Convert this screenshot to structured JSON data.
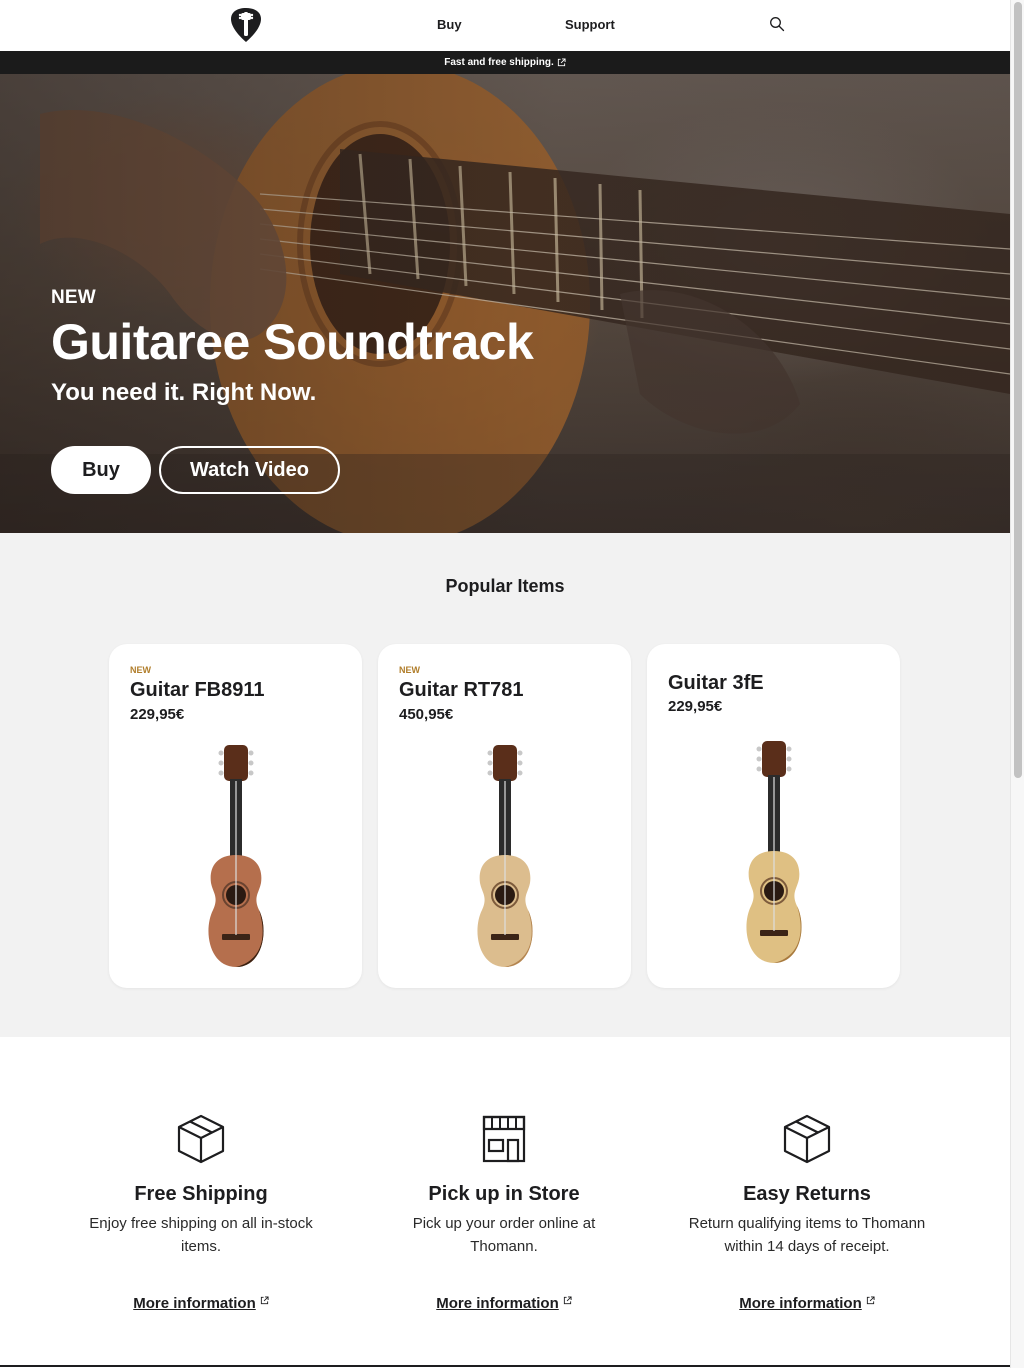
{
  "header": {
    "logo_icon": "guitar-pick-logo-icon",
    "nav": [
      {
        "label": "Buy"
      },
      {
        "label": "Support"
      }
    ],
    "search_icon": "search-icon"
  },
  "promo": {
    "text": "Fast and free shipping.",
    "icon": "external-link-icon"
  },
  "hero": {
    "eyebrow": "NEW",
    "title": "Guitaree Soundtrack",
    "subtitle": "You need it. Right Now.",
    "buy_label": "Buy",
    "video_label": "Watch Video"
  },
  "popular": {
    "title": "Popular Items",
    "items": [
      {
        "badge": "NEW",
        "name": "Guitar FB8911",
        "price": "229,95€",
        "body_color": "#b56f4d"
      },
      {
        "badge": "NEW",
        "name": "Guitar RT781",
        "price": "450,95€",
        "body_color": "#dcbd8e"
      },
      {
        "badge": "",
        "name": "Guitar 3fE",
        "price": "229,95€",
        "body_color": "#dfc083"
      }
    ]
  },
  "features": [
    {
      "icon": "box-icon",
      "title": "Free Shipping",
      "text": "Enjoy free shipping on all in-stock items.",
      "link": "More information"
    },
    {
      "icon": "store-icon",
      "title": "Pick up in Store",
      "text": "Pick up your order online at Thomann.",
      "link": "More information"
    },
    {
      "icon": "box-icon",
      "title": "Easy Returns",
      "text": "Return qualifying items to Thomann within 14 days of receipt.",
      "link": "More information"
    }
  ],
  "colors": {
    "accent_badge": "#b07d2a",
    "promo_bg": "#1b1b1b",
    "section_bg": "#f2f2f2"
  }
}
